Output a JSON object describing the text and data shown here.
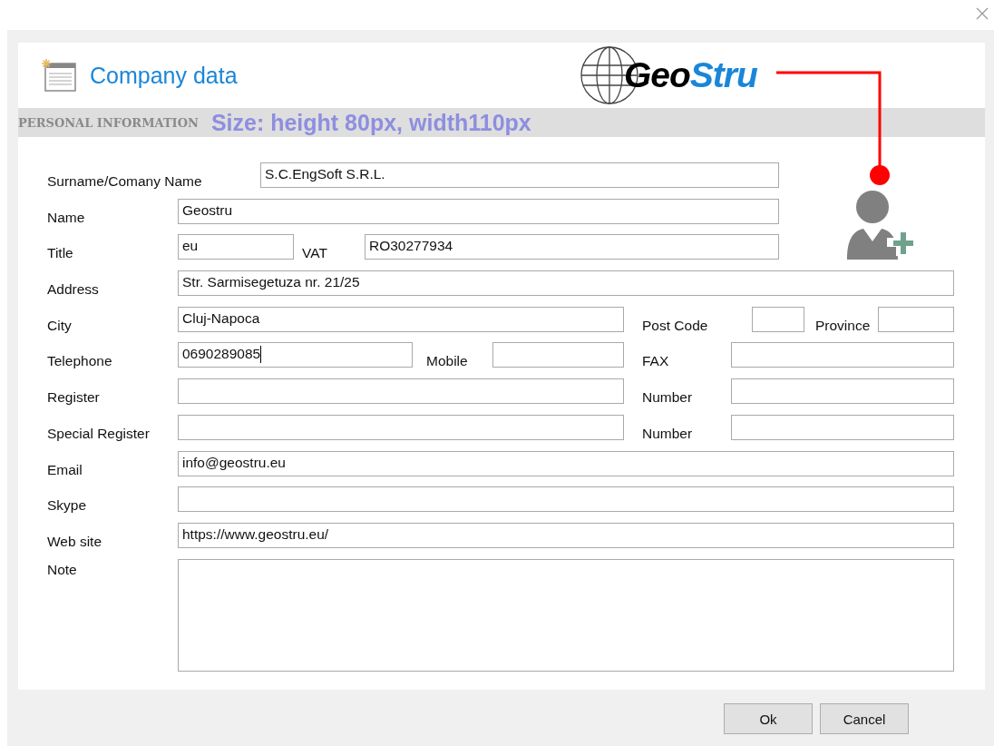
{
  "header": {
    "title": "Company data",
    "logo": {
      "part_1": "Geo",
      "part_2": "Stru"
    }
  },
  "section": {
    "title": "PERSONAL INFORMATION",
    "annotation": "Size: height 80px, width110px"
  },
  "form": {
    "rows": [
      {
        "items": [
          {
            "kind": "label",
            "text": "Surname/Comany Name"
          },
          {
            "kind": "field",
            "value": "S.C.EngSoft S.R.L.",
            "focused": false
          }
        ]
      },
      {
        "items": [
          {
            "kind": "label",
            "text": "Name"
          },
          {
            "kind": "field",
            "value": "Geostru",
            "focused": false
          }
        ]
      },
      {
        "items": [
          {
            "kind": "label",
            "text": "Title"
          },
          {
            "kind": "field",
            "value": "eu",
            "focused": false
          },
          {
            "kind": "label",
            "text": "VAT"
          },
          {
            "kind": "field",
            "value": "RO30277934",
            "focused": false
          }
        ]
      },
      {
        "items": [
          {
            "kind": "label",
            "text": "Address"
          },
          {
            "kind": "field",
            "value": "Str. Sarmisegetuza nr. 21/25",
            "focused": false
          }
        ]
      },
      {
        "items": [
          {
            "kind": "label",
            "text": "City"
          },
          {
            "kind": "field",
            "value": "Cluj-Napoca",
            "focused": false
          },
          {
            "kind": "label",
            "text": "Post Code"
          },
          {
            "kind": "field",
            "focused": false
          },
          {
            "kind": "label",
            "text": "Province"
          },
          {
            "kind": "field",
            "focused": false
          }
        ]
      },
      {
        "items": [
          {
            "kind": "label",
            "text": "Telephone"
          },
          {
            "kind": "field",
            "value": "0690289085",
            "focused": true
          },
          {
            "kind": "label",
            "text": "Mobile"
          },
          {
            "kind": "field",
            "focused": false
          },
          {
            "kind": "label",
            "text": "FAX"
          },
          {
            "kind": "field",
            "focused": false
          }
        ]
      },
      {
        "items": [
          {
            "kind": "label",
            "text": "Register"
          },
          {
            "kind": "field",
            "focused": false
          },
          {
            "kind": "label",
            "text": "Number"
          },
          {
            "kind": "field",
            "focused": false
          }
        ]
      },
      {
        "items": [
          {
            "kind": "label",
            "text": "Special Register"
          },
          {
            "kind": "field",
            "focused": false
          },
          {
            "kind": "label",
            "text": "Number"
          },
          {
            "kind": "field",
            "focused": false
          }
        ]
      },
      {
        "items": [
          {
            "kind": "label",
            "text": "Email"
          },
          {
            "kind": "field",
            "value": "info@geostru.eu",
            "focused": false
          }
        ]
      },
      {
        "items": [
          {
            "kind": "label",
            "text": "Skype"
          },
          {
            "kind": "field",
            "focused": false
          }
        ]
      },
      {
        "items": [
          {
            "kind": "label",
            "text": "Web site"
          },
          {
            "kind": "field",
            "value": "https://www.geostru.eu/",
            "focused": false
          }
        ]
      },
      {
        "items": [
          {
            "kind": "label",
            "text": "Note"
          },
          {
            "kind": "area",
            "focused": false
          }
        ]
      }
    ]
  },
  "buttons": [
    "Ok",
    "Cancel"
  ]
}
